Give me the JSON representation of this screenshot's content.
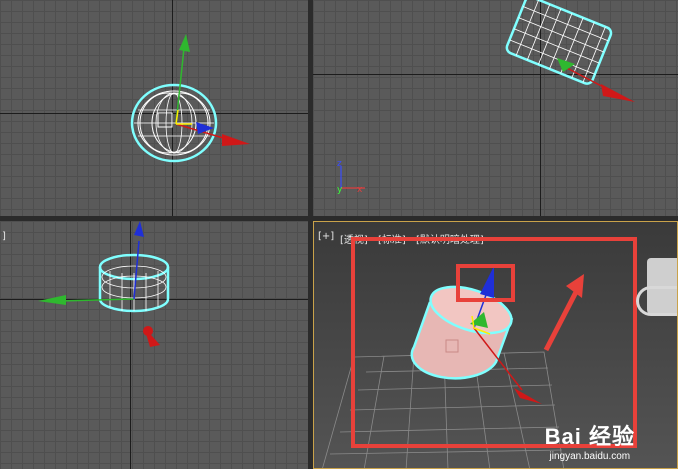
{
  "viewports": {
    "top": {
      "label": ""
    },
    "front": {
      "label": ""
    },
    "left": {
      "label": "]"
    },
    "perspective": {
      "label_plus": "[+]",
      "label_view": "[透视]",
      "label_shading": "[标准]",
      "label_lighting": "[默认明暗处理]"
    }
  },
  "axis_letters": {
    "z": "z",
    "y": "y",
    "x": "x"
  },
  "watermark": {
    "logo": "Bai 经验",
    "url": "jingyan.baidu.com"
  },
  "colors": {
    "grid_bg": "#5a5a5a",
    "selection_wire": "#7fffff",
    "annotation_red": "#e8413a",
    "gizmo_x": "#d01818",
    "gizmo_y": "#2fb82f",
    "gizmo_z": "#1f2fd8",
    "active_border": "#c9a24a"
  }
}
